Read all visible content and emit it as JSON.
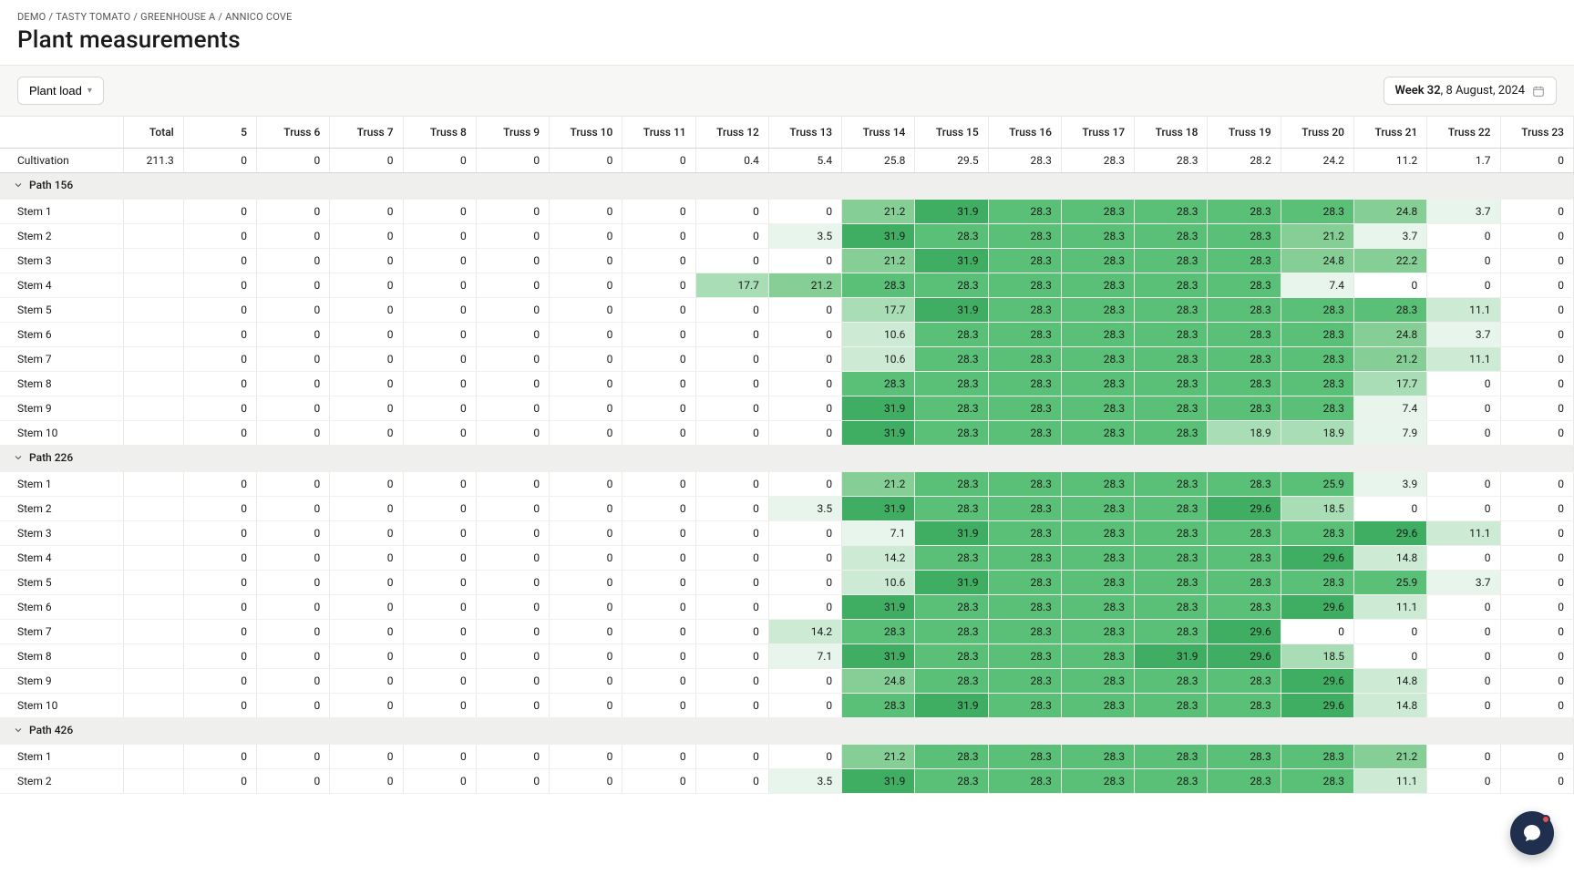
{
  "breadcrumb": [
    "DEMO",
    "TASTY TOMATO",
    "GREENHOUSE A",
    "ANNICO COVE"
  ],
  "page_title": "Plant measurements",
  "toolbar": {
    "plant_load_label": "Plant load"
  },
  "date": {
    "week_label": "Week 32",
    "date_label": "8 August, 2024"
  },
  "columns_label_col": "",
  "columns": [
    "Total",
    "5",
    "Truss 6",
    "Truss 7",
    "Truss 8",
    "Truss 9",
    "Truss 10",
    "Truss 11",
    "Truss 12",
    "Truss 13",
    "Truss 14",
    "Truss 15",
    "Truss 16",
    "Truss 17",
    "Truss 18",
    "Truss 19",
    "Truss 20",
    "Truss 21",
    "Truss 22",
    "Truss 23"
  ],
  "chart_data": {
    "type": "heatmap",
    "x": [
      "5",
      "Truss 6",
      "Truss 7",
      "Truss 8",
      "Truss 9",
      "Truss 10",
      "Truss 11",
      "Truss 12",
      "Truss 13",
      "Truss 14",
      "Truss 15",
      "Truss 16",
      "Truss 17",
      "Truss 18",
      "Truss 19",
      "Truss 20",
      "Truss 21",
      "Truss 22",
      "Truss 23"
    ],
    "note": "Cell color intensity encodes value magnitude; rows are stems grouped by path.",
    "groups": [
      {
        "type": "summary",
        "label": "Cultivation",
        "total": "211.3",
        "values": [
          "0",
          "0",
          "0",
          "0",
          "0",
          "0",
          "0",
          "0.4",
          "5.4",
          "25.8",
          "29.5",
          "28.3",
          "28.3",
          "28.3",
          "28.2",
          "24.2",
          "11.2",
          "1.7",
          "0"
        ]
      },
      {
        "type": "group",
        "label": "Path 156",
        "rows": [
          {
            "label": "Stem 1",
            "values": [
              "0",
              "0",
              "0",
              "0",
              "0",
              "0",
              "0",
              "0",
              "0",
              "21.2",
              "31.9",
              "28.3",
              "28.3",
              "28.3",
              "28.3",
              "28.3",
              "24.8",
              "3.7",
              "0"
            ]
          },
          {
            "label": "Stem 2",
            "values": [
              "0",
              "0",
              "0",
              "0",
              "0",
              "0",
              "0",
              "0",
              "3.5",
              "31.9",
              "28.3",
              "28.3",
              "28.3",
              "28.3",
              "28.3",
              "21.2",
              "3.7",
              "0",
              "0"
            ]
          },
          {
            "label": "Stem 3",
            "values": [
              "0",
              "0",
              "0",
              "0",
              "0",
              "0",
              "0",
              "0",
              "0",
              "21.2",
              "31.9",
              "28.3",
              "28.3",
              "28.3",
              "28.3",
              "24.8",
              "22.2",
              "0",
              "0"
            ]
          },
          {
            "label": "Stem 4",
            "values": [
              "0",
              "0",
              "0",
              "0",
              "0",
              "0",
              "0",
              "17.7",
              "21.2",
              "28.3",
              "28.3",
              "28.3",
              "28.3",
              "28.3",
              "28.3",
              "7.4",
              "0",
              "0",
              "0"
            ]
          },
          {
            "label": "Stem 5",
            "values": [
              "0",
              "0",
              "0",
              "0",
              "0",
              "0",
              "0",
              "0",
              "0",
              "17.7",
              "31.9",
              "28.3",
              "28.3",
              "28.3",
              "28.3",
              "28.3",
              "28.3",
              "11.1",
              "0"
            ]
          },
          {
            "label": "Stem 6",
            "values": [
              "0",
              "0",
              "0",
              "0",
              "0",
              "0",
              "0",
              "0",
              "0",
              "10.6",
              "28.3",
              "28.3",
              "28.3",
              "28.3",
              "28.3",
              "28.3",
              "24.8",
              "3.7",
              "0"
            ]
          },
          {
            "label": "Stem 7",
            "values": [
              "0",
              "0",
              "0",
              "0",
              "0",
              "0",
              "0",
              "0",
              "0",
              "10.6",
              "28.3",
              "28.3",
              "28.3",
              "28.3",
              "28.3",
              "28.3",
              "21.2",
              "11.1",
              "0"
            ]
          },
          {
            "label": "Stem 8",
            "values": [
              "0",
              "0",
              "0",
              "0",
              "0",
              "0",
              "0",
              "0",
              "0",
              "28.3",
              "28.3",
              "28.3",
              "28.3",
              "28.3",
              "28.3",
              "28.3",
              "17.7",
              "0",
              "0"
            ]
          },
          {
            "label": "Stem 9",
            "values": [
              "0",
              "0",
              "0",
              "0",
              "0",
              "0",
              "0",
              "0",
              "0",
              "31.9",
              "28.3",
              "28.3",
              "28.3",
              "28.3",
              "28.3",
              "28.3",
              "7.4",
              "0",
              "0"
            ]
          },
          {
            "label": "Stem 10",
            "values": [
              "0",
              "0",
              "0",
              "0",
              "0",
              "0",
              "0",
              "0",
              "0",
              "31.9",
              "28.3",
              "28.3",
              "28.3",
              "28.3",
              "18.9",
              "18.9",
              "7.9",
              "0",
              "0"
            ]
          }
        ]
      },
      {
        "type": "group",
        "label": "Path 226",
        "rows": [
          {
            "label": "Stem 1",
            "values": [
              "0",
              "0",
              "0",
              "0",
              "0",
              "0",
              "0",
              "0",
              "0",
              "21.2",
              "28.3",
              "28.3",
              "28.3",
              "28.3",
              "28.3",
              "25.9",
              "3.9",
              "0",
              "0"
            ]
          },
          {
            "label": "Stem 2",
            "values": [
              "0",
              "0",
              "0",
              "0",
              "0",
              "0",
              "0",
              "0",
              "3.5",
              "31.9",
              "28.3",
              "28.3",
              "28.3",
              "28.3",
              "29.6",
              "18.5",
              "0",
              "0",
              "0"
            ]
          },
          {
            "label": "Stem 3",
            "values": [
              "0",
              "0",
              "0",
              "0",
              "0",
              "0",
              "0",
              "0",
              "0",
              "7.1",
              "31.9",
              "28.3",
              "28.3",
              "28.3",
              "28.3",
              "28.3",
              "29.6",
              "11.1",
              "0"
            ]
          },
          {
            "label": "Stem 4",
            "values": [
              "0",
              "0",
              "0",
              "0",
              "0",
              "0",
              "0",
              "0",
              "0",
              "14.2",
              "28.3",
              "28.3",
              "28.3",
              "28.3",
              "28.3",
              "29.6",
              "14.8",
              "0",
              "0"
            ]
          },
          {
            "label": "Stem 5",
            "values": [
              "0",
              "0",
              "0",
              "0",
              "0",
              "0",
              "0",
              "0",
              "0",
              "10.6",
              "31.9",
              "28.3",
              "28.3",
              "28.3",
              "28.3",
              "28.3",
              "25.9",
              "3.7",
              "0"
            ]
          },
          {
            "label": "Stem 6",
            "values": [
              "0",
              "0",
              "0",
              "0",
              "0",
              "0",
              "0",
              "0",
              "0",
              "31.9",
              "28.3",
              "28.3",
              "28.3",
              "28.3",
              "28.3",
              "29.6",
              "11.1",
              "0",
              "0"
            ]
          },
          {
            "label": "Stem 7",
            "values": [
              "0",
              "0",
              "0",
              "0",
              "0",
              "0",
              "0",
              "0",
              "14.2",
              "28.3",
              "28.3",
              "28.3",
              "28.3",
              "28.3",
              "29.6",
              "0",
              "0",
              "0",
              "0"
            ]
          },
          {
            "label": "Stem 8",
            "values": [
              "0",
              "0",
              "0",
              "0",
              "0",
              "0",
              "0",
              "0",
              "7.1",
              "31.9",
              "28.3",
              "28.3",
              "28.3",
              "31.9",
              "29.6",
              "18.5",
              "0",
              "0",
              "0"
            ]
          },
          {
            "label": "Stem 9",
            "values": [
              "0",
              "0",
              "0",
              "0",
              "0",
              "0",
              "0",
              "0",
              "0",
              "24.8",
              "28.3",
              "28.3",
              "28.3",
              "28.3",
              "28.3",
              "29.6",
              "14.8",
              "0",
              "0"
            ]
          },
          {
            "label": "Stem 10",
            "values": [
              "0",
              "0",
              "0",
              "0",
              "0",
              "0",
              "0",
              "0",
              "0",
              "28.3",
              "31.9",
              "28.3",
              "28.3",
              "28.3",
              "28.3",
              "29.6",
              "14.8",
              "0",
              "0"
            ]
          }
        ]
      },
      {
        "type": "group",
        "label": "Path 426",
        "rows": [
          {
            "label": "Stem 1",
            "values": [
              "0",
              "0",
              "0",
              "0",
              "0",
              "0",
              "0",
              "0",
              "0",
              "21.2",
              "28.3",
              "28.3",
              "28.3",
              "28.3",
              "28.3",
              "28.3",
              "21.2",
              "0",
              "0"
            ]
          },
          {
            "label": "Stem 2",
            "values": [
              "0",
              "0",
              "0",
              "0",
              "0",
              "0",
              "0",
              "0",
              "3.5",
              "31.9",
              "28.3",
              "28.3",
              "28.3",
              "28.3",
              "28.3",
              "28.3",
              "11.1",
              "0",
              "0"
            ]
          }
        ]
      }
    ]
  }
}
